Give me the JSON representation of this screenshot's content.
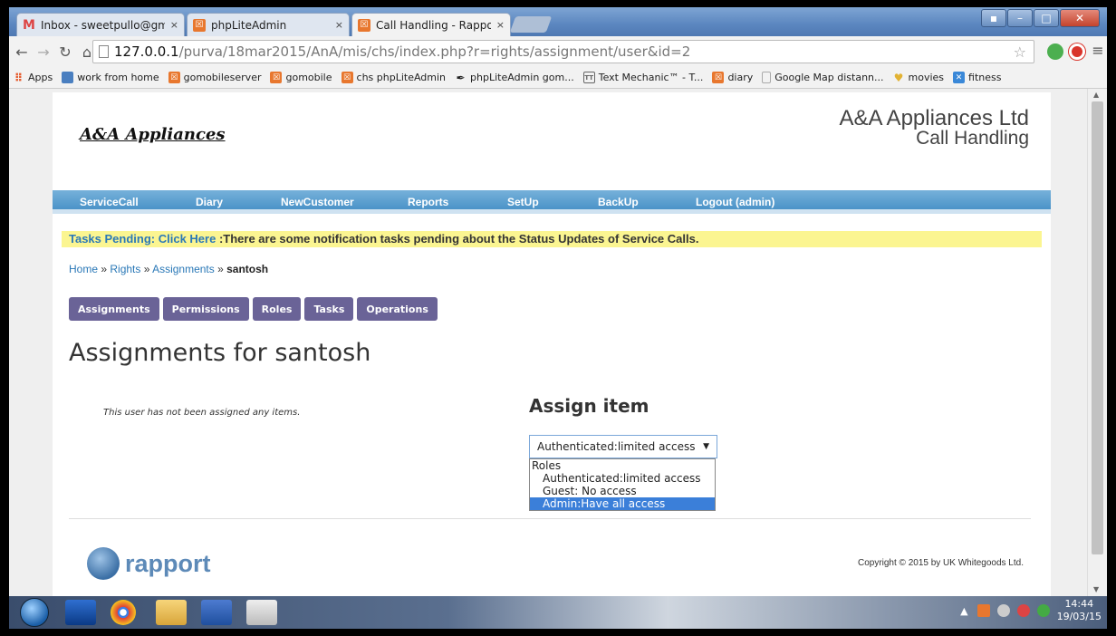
{
  "browser": {
    "tabs": [
      {
        "title": "Inbox - sweetpullo@gmai",
        "close": "×"
      },
      {
        "title": "phpLiteAdmin",
        "close": "×"
      },
      {
        "title": "Call Handling - Rapport -",
        "close": "×"
      }
    ],
    "url_host": "127.0.0.1",
    "url_path": "/purva/18mar2015/AnA/mis/chs/index.php?r=rights/assignment/user&id=2",
    "bookmarks": [
      {
        "label": "Apps",
        "icon": "apps-grid-icon",
        "color": "#e65c2e"
      },
      {
        "label": "work from home",
        "icon": "folder-icon",
        "color": "#4a7fc0"
      },
      {
        "label": "gomobileserver",
        "icon": "phplite-icon",
        "color": "#e8772e"
      },
      {
        "label": "gomobile",
        "icon": "phplite-icon",
        "color": "#e8772e"
      },
      {
        "label": "chs phpLiteAdmin",
        "icon": "phplite-icon",
        "color": "#e8772e"
      },
      {
        "label": "phpLiteAdmin gom...",
        "icon": "feather-icon",
        "color": "#222222"
      },
      {
        "label": "Text Mechanic™ - T...",
        "icon": "text-mechanic-icon",
        "color": "#666666"
      },
      {
        "label": "diary",
        "icon": "phplite-icon",
        "color": "#e8772e"
      },
      {
        "label": "Google Map distann...",
        "icon": "page-icon",
        "color": "#aaaaaa"
      },
      {
        "label": "movies",
        "icon": "heart-icon",
        "color": "#e2b233"
      },
      {
        "label": "fitness",
        "icon": "fitness-icon",
        "color": "#3a88d8"
      }
    ]
  },
  "header": {
    "logo": "A&A Appliances",
    "brand_line1": "A&A Appliances Ltd",
    "brand_line2": "Call Handling"
  },
  "menu": [
    "ServiceCall",
    "Diary",
    "NewCustomer",
    "Reports",
    "SetUp",
    "BackUp",
    "Logout (admin)"
  ],
  "notice": {
    "link": "Tasks Pending: Click Here",
    "text": " :There are some notification tasks pending about the Status Updates of Service Calls."
  },
  "breadcrumb": {
    "home": "Home",
    "rights": "Rights",
    "assignments": "Assignments",
    "sep": " » ",
    "current": "santosh"
  },
  "subtabs": [
    "Assignments",
    "Permissions",
    "Roles",
    "Tasks",
    "Operations"
  ],
  "heading": "Assignments for santosh",
  "empty_message": "This user has not been assigned any items.",
  "assign": {
    "title": "Assign item",
    "selected": "Authenticated:limited access",
    "group": "Roles",
    "options": [
      "Authenticated:limited access",
      "Guest: No access",
      "Admin:Have all access"
    ],
    "highlighted": "Admin:Have all access"
  },
  "footer": {
    "brand": "rapport",
    "copyright": "Copyright © 2015 by UK Whitegoods Ltd."
  },
  "taskbar": {
    "time": "14:44",
    "date": "19/03/15"
  }
}
